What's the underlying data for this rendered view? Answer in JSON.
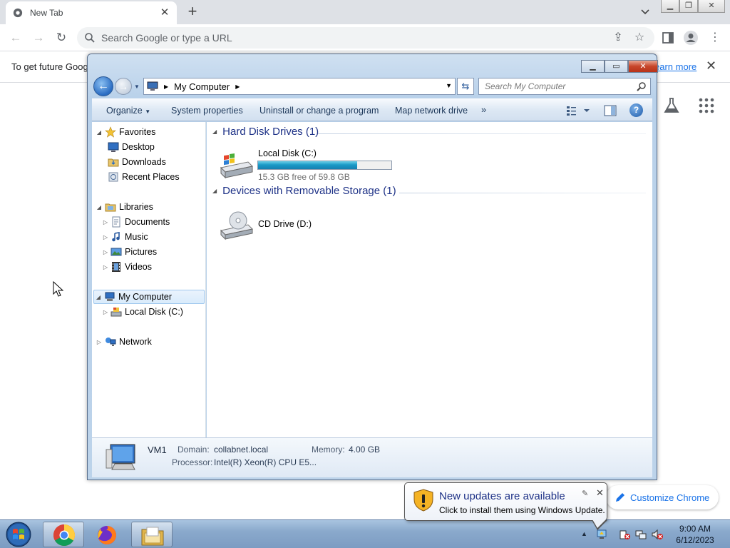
{
  "chrome": {
    "tab_title": "New Tab",
    "omnibox_placeholder": "Search Google or type a URL",
    "infobar_message": "To get future Goog",
    "infobar_link": "earn more",
    "customize_label": "Customize Chrome"
  },
  "explorer": {
    "address_label": "My Computer",
    "search_placeholder": "Search My Computer",
    "commands": {
      "organize": "Organize",
      "system_properties": "System properties",
      "uninstall": "Uninstall or change a program",
      "map_drive": "Map network drive",
      "more": "»"
    },
    "nav": {
      "favorites": "Favorites",
      "desktop": "Desktop",
      "downloads": "Downloads",
      "recent_places": "Recent Places",
      "libraries": "Libraries",
      "documents": "Documents",
      "music": "Music",
      "pictures": "Pictures",
      "videos": "Videos",
      "my_computer": "My Computer",
      "local_disk": "Local Disk (C:)",
      "network": "Network"
    },
    "groups": {
      "hard_disks": "Hard Disk Drives (1)",
      "removable": "Devices with Removable Storage (1)"
    },
    "drives": {
      "c_name": "Local Disk (C:)",
      "c_free": "15.3 GB free of 59.8 GB",
      "c_used_fraction": 0.744,
      "d_name": "CD Drive (D:)"
    },
    "details": {
      "computer_name": "VM1",
      "domain_label": "Domain:",
      "domain_value": "collabnet.local",
      "memory_label": "Memory:",
      "memory_value": "4.00 GB",
      "processor_label": "Processor:",
      "processor_value": "Intel(R) Xeon(R) CPU E5..."
    }
  },
  "notification": {
    "title": "New updates are available",
    "text": "Click to install them using Windows Update."
  },
  "taskbar": {
    "time": "9:00 AM",
    "date": "6/12/2023"
  },
  "colors": {
    "chrome_accent": "#1a73e8",
    "explorer_frame": "#b9d1ea",
    "group_header": "#1e3287",
    "drive_fill": "#1a9ac7"
  }
}
